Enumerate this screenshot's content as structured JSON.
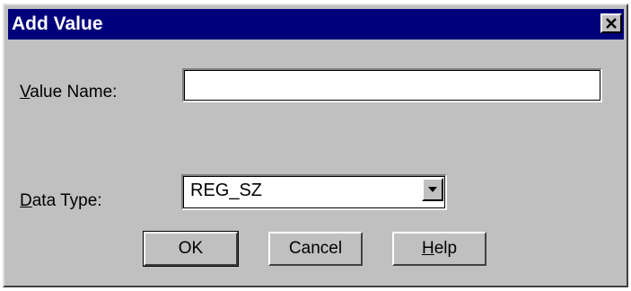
{
  "window": {
    "title": "Add Value",
    "close_glyph": "✕"
  },
  "form": {
    "value_name": {
      "label_prefix": "",
      "label_mnemonic": "V",
      "label_rest": "alue Name:",
      "value": ""
    },
    "data_type": {
      "label_mnemonic": "D",
      "label_rest": "ata Type:",
      "selected": "REG_SZ"
    }
  },
  "buttons": {
    "ok": "OK",
    "cancel": "Cancel",
    "help_mnemonic": "H",
    "help_rest": "elp"
  },
  "icons": {
    "close": "close-icon",
    "dropdown": "chevron-down-icon"
  },
  "colors": {
    "titlebar": "#00007b",
    "face": "#c0c0c0"
  }
}
